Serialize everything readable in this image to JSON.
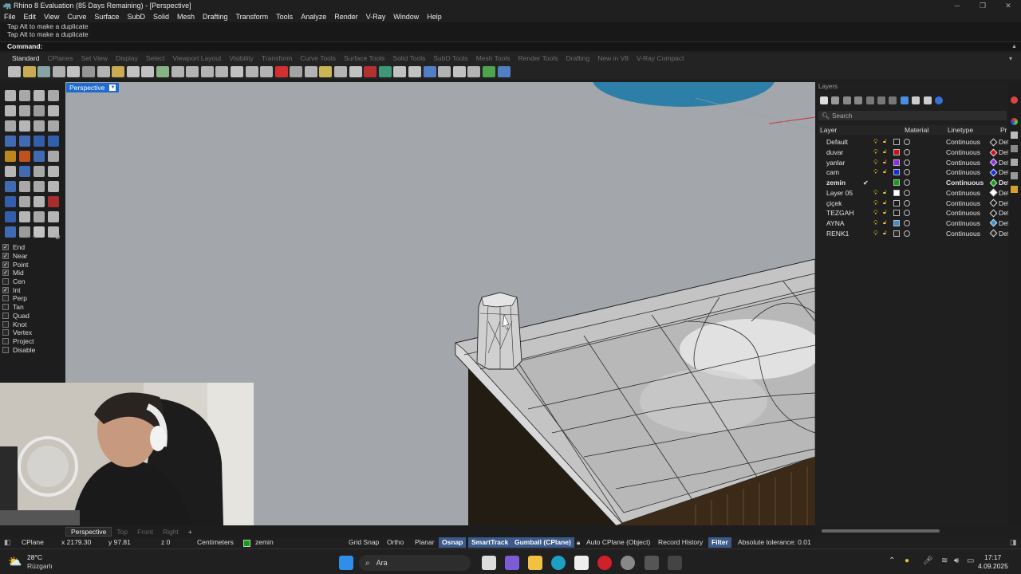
{
  "window": {
    "title": "Rhino 8 Evaluation (85 Days Remaining) - [Perspective]"
  },
  "menu": [
    "File",
    "Edit",
    "View",
    "Curve",
    "Surface",
    "SubD",
    "Solid",
    "Mesh",
    "Drafting",
    "Transform",
    "Tools",
    "Analyze",
    "Render",
    "V-Ray",
    "Window",
    "Help"
  ],
  "history": [
    "Tap Alt to make a duplicate",
    "Tap Alt to make a duplicate"
  ],
  "command": {
    "label": "Command:"
  },
  "toolbar_tabs": [
    "Standard",
    "CPlanes",
    "Set View",
    "Display",
    "Select",
    "Viewport Layout",
    "Visibility",
    "Transform",
    "Curve Tools",
    "Surface Tools",
    "Solid Tools",
    "SubD Tools",
    "Mesh Tools",
    "Render Tools",
    "Drafting",
    "New in V8",
    "V-Ray Compact"
  ],
  "toolbar_icon_colors": [
    "#d8d8d8",
    "#e8c35c",
    "#9bb",
    "#c8c8c8",
    "#ddd",
    "#aaa",
    "#ccc",
    "#e8c35c",
    "#ddd",
    "#ddd",
    "#9c9",
    "#ccc",
    "#ccc",
    "#ccc",
    "#ccc",
    "#ddd",
    "#ccc",
    "#ccc",
    "#e33",
    "#bbb",
    "#ccc",
    "#e8d05c",
    "#ccc",
    "#ddd",
    "#c33",
    "#4a8",
    "#ddd",
    "#ddd",
    "#5a8fe0",
    "#ccc",
    "#ddd",
    "#ccc",
    "#5b5",
    "#5a8fe0"
  ],
  "viewport": {
    "name": "Perspective"
  },
  "osnaps": [
    {
      "label": "End",
      "on": true
    },
    {
      "label": "Near",
      "on": true
    },
    {
      "label": "Point",
      "on": true
    },
    {
      "label": "Mid",
      "on": true
    },
    {
      "label": "Cen",
      "on": false
    },
    {
      "label": "Int",
      "on": true
    },
    {
      "label": "Perp",
      "on": false
    },
    {
      "label": "Tan",
      "on": false
    },
    {
      "label": "Quad",
      "on": false
    },
    {
      "label": "Knot",
      "on": false
    },
    {
      "label": "Vertex",
      "on": false
    },
    {
      "label": "Project",
      "on": false
    },
    {
      "label": "Disable",
      "on": false
    }
  ],
  "viewport_tabs": [
    "Perspective",
    "Top",
    "Front",
    "Right"
  ],
  "layers": {
    "title": "Layers",
    "search_placeholder": "Search",
    "columns": {
      "layer": "Layer",
      "material": "Material",
      "linetype": "Linetype",
      "print": "Pr"
    },
    "rows": [
      {
        "name": "Default",
        "color": "#1a1a1a",
        "linetype": "Continuous",
        "print": "Def",
        "current": false,
        "dia": "#1a1a1a"
      },
      {
        "name": "duvar",
        "color": "#d01010",
        "linetype": "Continuous",
        "print": "Def",
        "current": false,
        "dia": "#d01010"
      },
      {
        "name": "yanlar",
        "color": "#8a2be2",
        "linetype": "Continuous",
        "print": "Def",
        "current": false,
        "dia": "#8a2be2"
      },
      {
        "name": "cam",
        "color": "#1030e0",
        "linetype": "Continuous",
        "print": "Def",
        "current": false,
        "dia": "#1030e0"
      },
      {
        "name": "zemin",
        "color": "#10a010",
        "linetype": "Continuous",
        "print": "Def",
        "current": true,
        "dia": "#10a010"
      },
      {
        "name": "Layer 05",
        "color": "#ffffff",
        "linetype": "Continuous",
        "print": "Def",
        "current": false,
        "dia": "#ffffff"
      },
      {
        "name": "çiçek",
        "color": "#1a1a1a",
        "linetype": "Continuous",
        "print": "Def",
        "current": false,
        "dia": "#1a1a1a"
      },
      {
        "name": "TEZGAH",
        "color": "#1a1a1a",
        "linetype": "Continuous",
        "print": "Def",
        "current": false,
        "dia": "#1a1a1a"
      },
      {
        "name": "AYNA",
        "color": "#3a8fd0",
        "linetype": "Continuous",
        "print": "Def",
        "current": false,
        "dia": "#3a8fd0"
      },
      {
        "name": "RENK1",
        "color": "#2a2a2a",
        "linetype": "Continuous",
        "print": "Def",
        "current": false,
        "dia": "#2a2a2a"
      }
    ]
  },
  "status": {
    "cplane": "CPlane",
    "x": "x 2179.30",
    "y": "y 97.81",
    "z": "z 0",
    "units": "Centimeters",
    "layer": "zemin",
    "layer_color": "#10a010",
    "grid_snap": "Grid Snap",
    "ortho": "Ortho",
    "planar": "Planar",
    "osnap": "Osnap",
    "smarttrack": "SmartTrack",
    "gumball": "Gumball (CPlane)",
    "auto_cplane": "Auto CPlane (Object)",
    "record_history": "Record History",
    "filter": "Filter",
    "tolerance": "Absolute tolerance: 0.01"
  },
  "taskbar": {
    "weather_temp": "28°C",
    "weather_desc": "Rüzgarlı",
    "search": "Ara",
    "time": "17:17",
    "date": "4.09.2025"
  }
}
